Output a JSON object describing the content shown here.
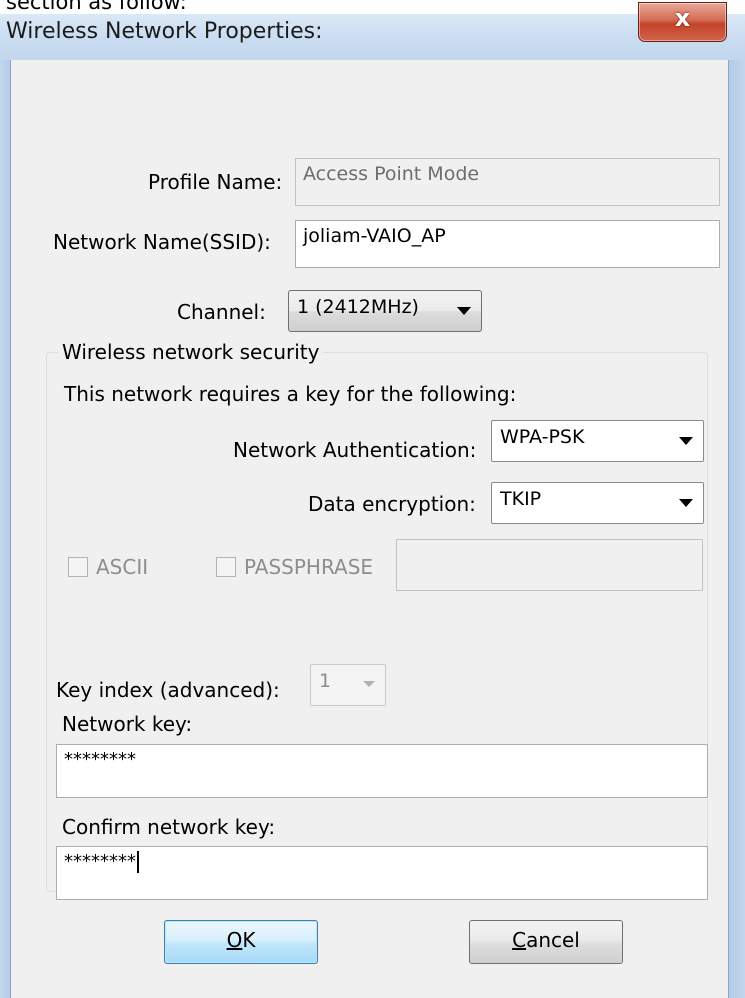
{
  "page": {
    "cut_text": "section as follow:"
  },
  "window": {
    "title": "Wireless Network Properties:",
    "close_glyph": "x"
  },
  "form": {
    "profile_name": {
      "label": "Profile Name:",
      "value": "Access Point Mode"
    },
    "ssid": {
      "label": "Network Name(SSID):",
      "value": "joliam-VAIO_AP"
    },
    "channel": {
      "label": "Channel:",
      "value": "1 (2412MHz)"
    }
  },
  "security": {
    "group_title": "Wireless network security",
    "description": "This network requires a key for the following:",
    "authentication": {
      "label": "Network Authentication:",
      "value": "WPA-PSK"
    },
    "encryption": {
      "label": "Data encryption:",
      "value": "TKIP"
    },
    "ascii": {
      "label": "ASCII",
      "checked": false
    },
    "passphrase": {
      "label": "PASSPHRASE",
      "checked": false,
      "value": ""
    },
    "key_index": {
      "label": "Key index (advanced):",
      "value": "1"
    },
    "network_key": {
      "label": "Network key:",
      "value": "********"
    },
    "confirm_key": {
      "label": "Confirm network key:",
      "value": "********"
    }
  },
  "buttons": {
    "ok": {
      "mnemonic": "O",
      "rest": "K"
    },
    "cancel": {
      "mnemonic": "C",
      "rest": "ancel"
    }
  },
  "colors": {
    "title_bar": "#c9dcf1",
    "dialog_bg": "#f0f0f0",
    "close_button": "#c3432a",
    "ok_button_border": "#3c7fb1"
  }
}
